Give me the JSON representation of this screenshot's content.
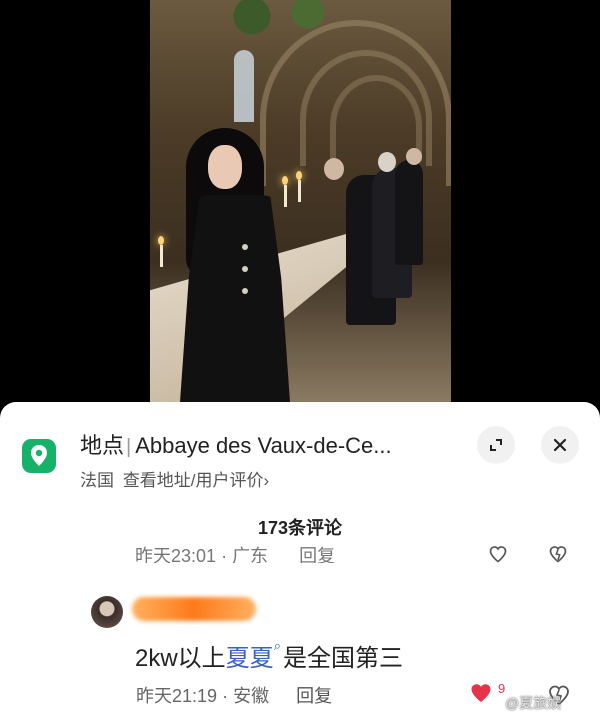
{
  "location": {
    "icon": "map-pin-icon",
    "label": "地点",
    "name": "Abbaye des Vaux-de-Ce...",
    "country": "法国",
    "link_text": "查看地址/用户评价",
    "chevron": "›"
  },
  "comments": {
    "count_label": "173条评论",
    "previous_meta": {
      "time": "昨天23:01",
      "region": "广东",
      "reply_label": "回复"
    },
    "item": {
      "text_prefix": "2kw以上",
      "highlight": "夏夏",
      "text_suffix": "是全国第三",
      "time": "昨天21:19",
      "separator": "·",
      "region": "安徽",
      "reply_label": "回复",
      "likes": "9"
    }
  },
  "watermark": "@夏旅娱",
  "colors": {
    "accent_green": "#17b26a",
    "link_blue": "#3a62b8",
    "like_red": "#e5334a"
  }
}
